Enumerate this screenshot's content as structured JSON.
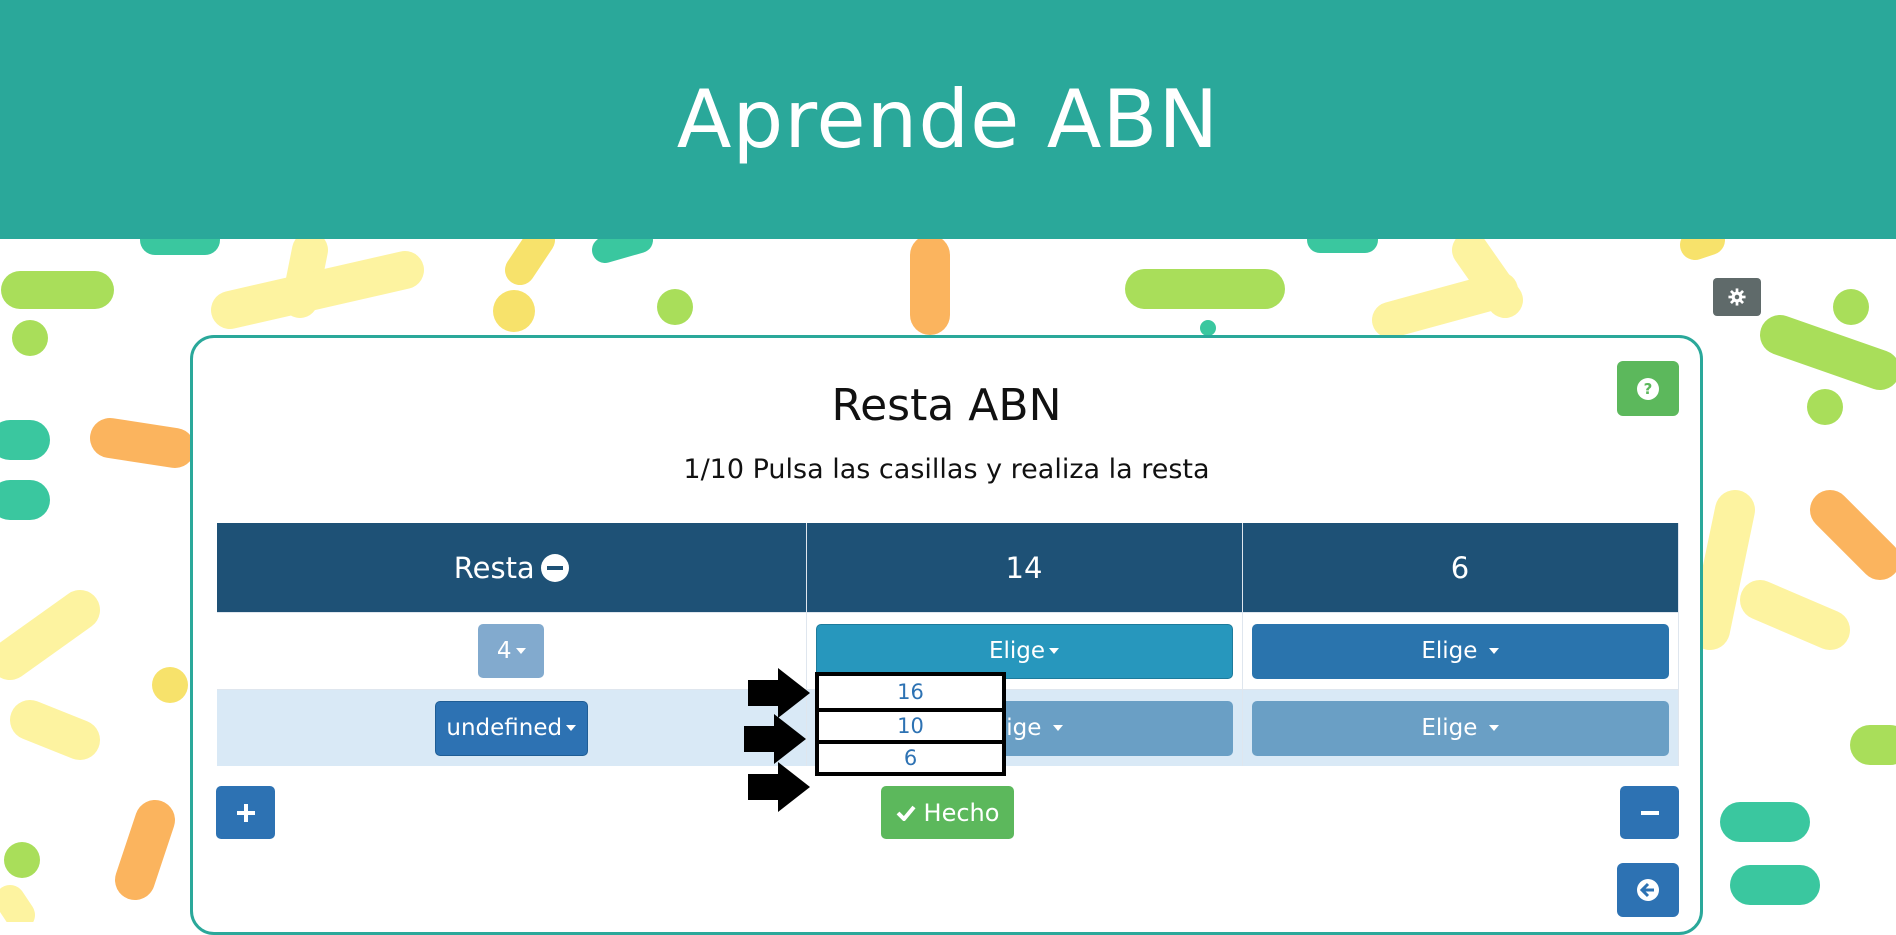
{
  "header": {
    "title": "Aprende ABN"
  },
  "exercise": {
    "title": "Resta ABN",
    "instruction": "1/10 Pulsa las casillas y realiza la resta"
  },
  "table": {
    "headers": {
      "op_label": "Resta",
      "minuend": "14",
      "subtrahend": "6"
    },
    "rows": [
      {
        "op_value": "4",
        "col1": "Elige",
        "col2": "Elige"
      },
      {
        "op_value": "undefined",
        "col1": "Elige",
        "col2": "Elige"
      }
    ]
  },
  "dropdown": {
    "options": [
      "16",
      "10",
      "6"
    ]
  },
  "actions": {
    "done_label": "Hecho"
  },
  "icons": {
    "settings": "gear-icon",
    "help": "question-circle-icon",
    "add_row": "plus-icon",
    "remove_row": "minus-icon",
    "back": "arrow-circle-left-icon",
    "done": "check-icon"
  },
  "colors": {
    "header": "#2aa89a",
    "table_header": "#1e5176",
    "primary": "#2d72b3",
    "success": "#5cb85c"
  }
}
